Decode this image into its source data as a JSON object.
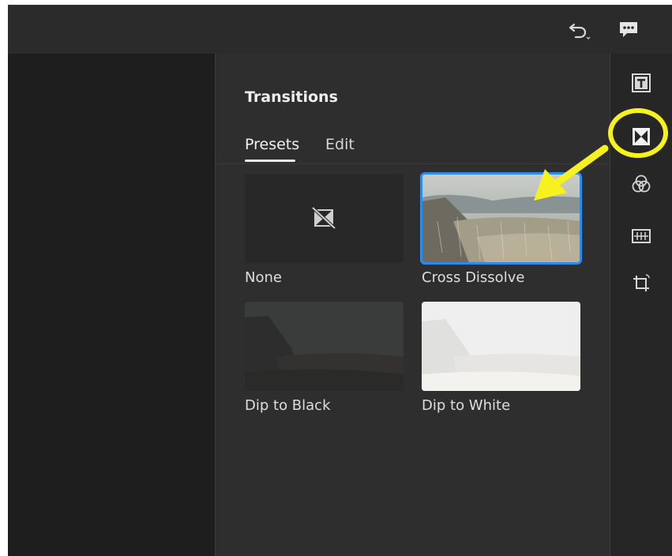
{
  "topbar": {
    "undo_icon": "undo-icon",
    "comment_icon": "comment-icon"
  },
  "panel": {
    "title": "Transitions",
    "tabs": [
      {
        "label": "Presets",
        "active": true
      },
      {
        "label": "Edit",
        "active": false
      }
    ],
    "presets": [
      {
        "label": "None",
        "selected": false
      },
      {
        "label": "Cross Dissolve",
        "selected": true
      },
      {
        "label": "Dip to Black",
        "selected": false
      },
      {
        "label": "Dip to White",
        "selected": false
      }
    ]
  },
  "rail": {
    "icons": [
      "titles-icon",
      "transitions-icon",
      "color-icon",
      "audio-icon",
      "crop-icon"
    ],
    "active": "transitions-icon"
  },
  "colors": {
    "accent": "#2d8ceb",
    "annotation": "#f7f11d",
    "panel_bg": "#2e2e2e"
  }
}
